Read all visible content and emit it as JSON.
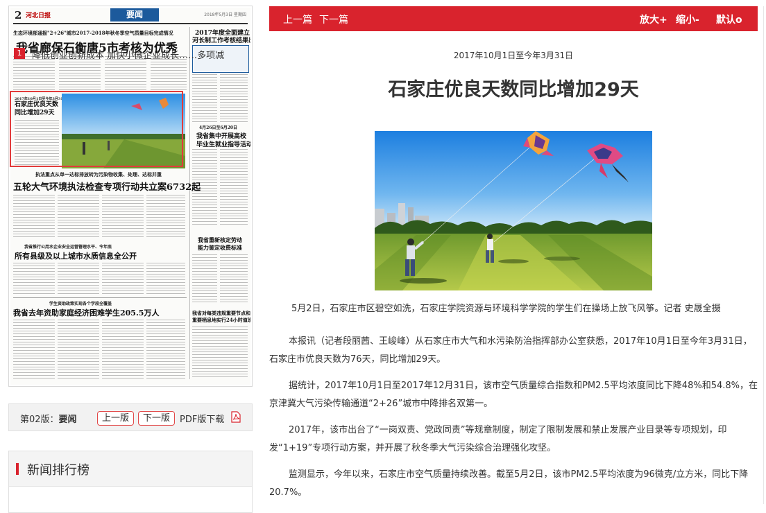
{
  "left": {
    "paper_page": {
      "page_number": "2",
      "logo": "河北日报",
      "section": "要闻",
      "date": "2018年5月3日 星期四",
      "kicker_1": "生态环境部通报\"2+26\"城市2017-2018年秋冬季空气质量目标完成情况",
      "headline_1": "我省廊保石衡唐5市考核为优秀",
      "side_headline_1": "2017年度全面建立",
      "side_headline_2": "河长制工作考核结果出炉",
      "featured_kicker": "2017年10月1日至今年3月31日",
      "featured_title_1": "石家庄优良天数",
      "featured_title_2": "同比增加29天",
      "side_kicker_2": "4月26日至6月20日",
      "side_headline_3": "我省集中开展高校",
      "side_headline_4": "毕业生就业指导活动",
      "kicker_2": "执法重点从单一达标排放转为污染物收集、处理、达标并重",
      "headline_2": "五轮大气环境执法检查专项行动共立案6732起",
      "side_headline_5": "我省重新核定劳动",
      "side_headline_6": "能力鉴定收费标准",
      "kicker_3": "我省推行公用水企业安全运营管理水平、今年底",
      "headline_3": "所有县级及以上城市水质信息全公开",
      "kicker_4": "学生资助政策实现各个学段全覆盖",
      "headline_4": "我省去年资助家庭经济困难学生205.5万人",
      "side_headline_7": "我省对每类违规重要节点和",
      "side_headline_8": "重要栖息地实行24小时值班"
    },
    "page_nav": {
      "label_prefix": "第02版：",
      "label_section": "要闻",
      "prev_page": "上一版",
      "next_page": "下一版",
      "pdf_download": "PDF版下载"
    },
    "ranking": {
      "title": "新闻排行榜",
      "items": [
        {
          "rank": "1",
          "text": "降低创业创新成本  加快小微企业成长……多项减"
        }
      ]
    }
  },
  "toolbar": {
    "prev_article": "上一篇",
    "next_article": "下一篇",
    "zoom_in": "放大+",
    "zoom_out": "缩小-",
    "default_size": "默认o",
    "bg_color": "#d9232d"
  },
  "article": {
    "subtitle": "2017年10月1日至今年3月31日",
    "title": "石家庄优良天数同比增加29天",
    "photo_caption": "5月2日，石家庄市区碧空如洗，石家庄学院资源与环境科学学院的学生们在操场上放飞风筝。记者 史晟全摄",
    "paragraphs": [
      "本报讯（记者段丽茜、王峻峰）从石家庄市大气和水污染防治指挥部办公室获悉，2017年10月1日至今年3月31日，石家庄市优良天数为76天，同比增加29天。",
      "据统计，2017年10月1日至2017年12月31日，该市空气质量综合指数和PM2.5平均浓度同比下降48%和54.8%，在京津冀大气污染传输通道“2+26”城市中降排名双第一。",
      "2017年，该市出台了“一岗双责、党政同责”等规章制度，制定了限制发展和禁止发展产业目录等专项规划，印发“1+19”专项行动方案，并开展了秋冬季大气污染综合治理强化攻坚。",
      "监测显示，今年以来，石家庄市空气质量持续改善。截至5月2日，该市PM2.5平均浓度为96微克/立方米，同比下降20.7%。"
    ]
  }
}
